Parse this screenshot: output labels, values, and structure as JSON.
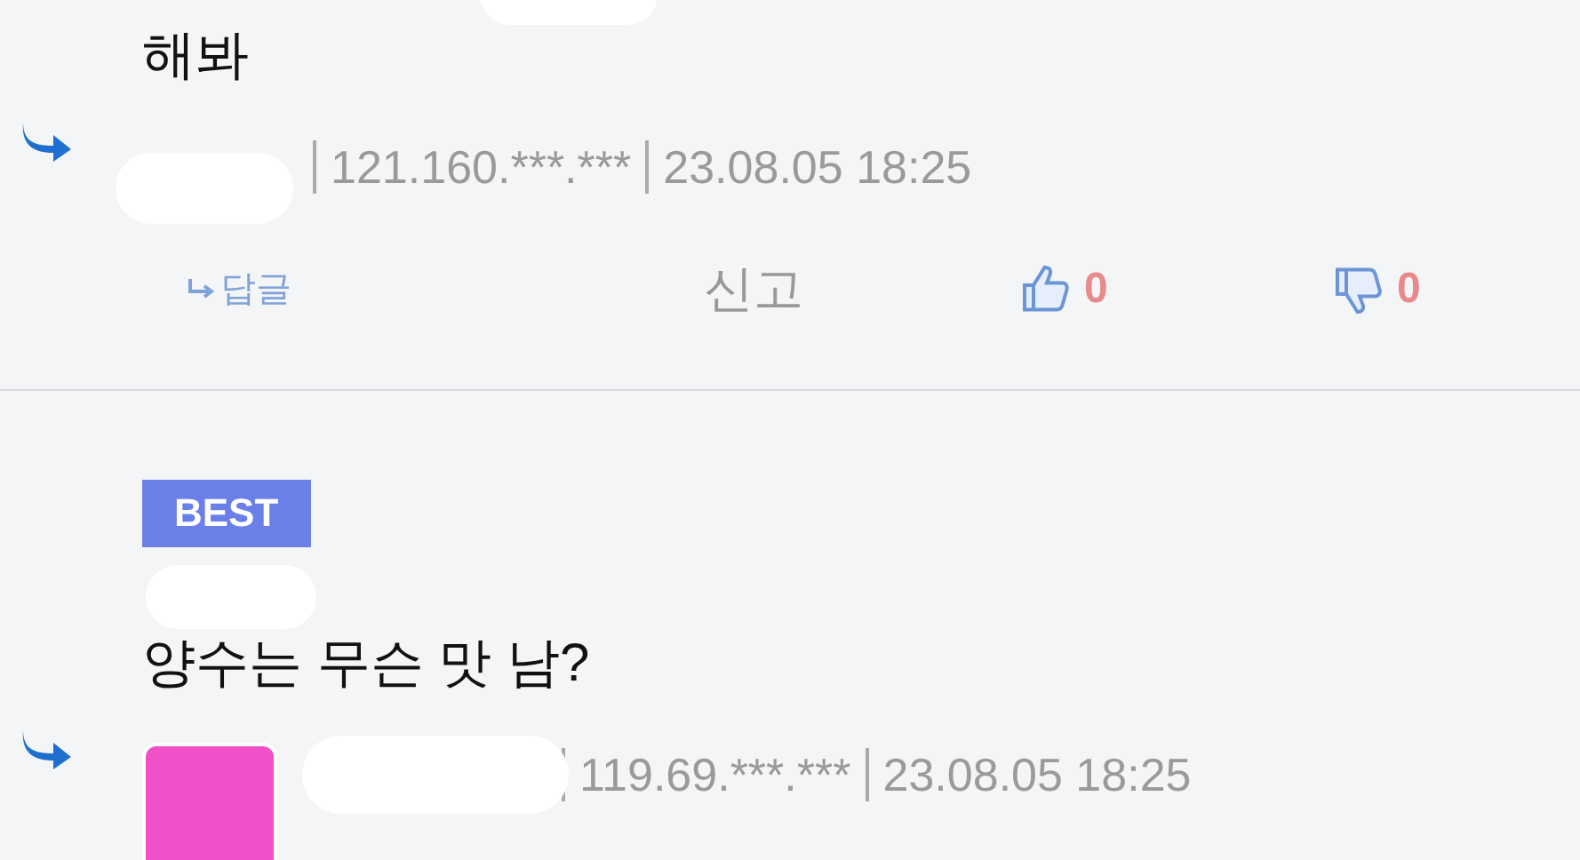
{
  "comments": [
    {
      "text": "해봐",
      "meta": [
        "121.160.***.***",
        "23.08.05 18:25"
      ],
      "actions": {
        "reply": "답글",
        "report": "신고",
        "likes": "0",
        "dislikes": "0"
      }
    },
    {
      "best": "BEST",
      "text": "양수는 무슨 맛 남?",
      "avatar": true,
      "meta": [
        "119.69.***.***",
        "23.08.05 18:25"
      ]
    }
  ]
}
